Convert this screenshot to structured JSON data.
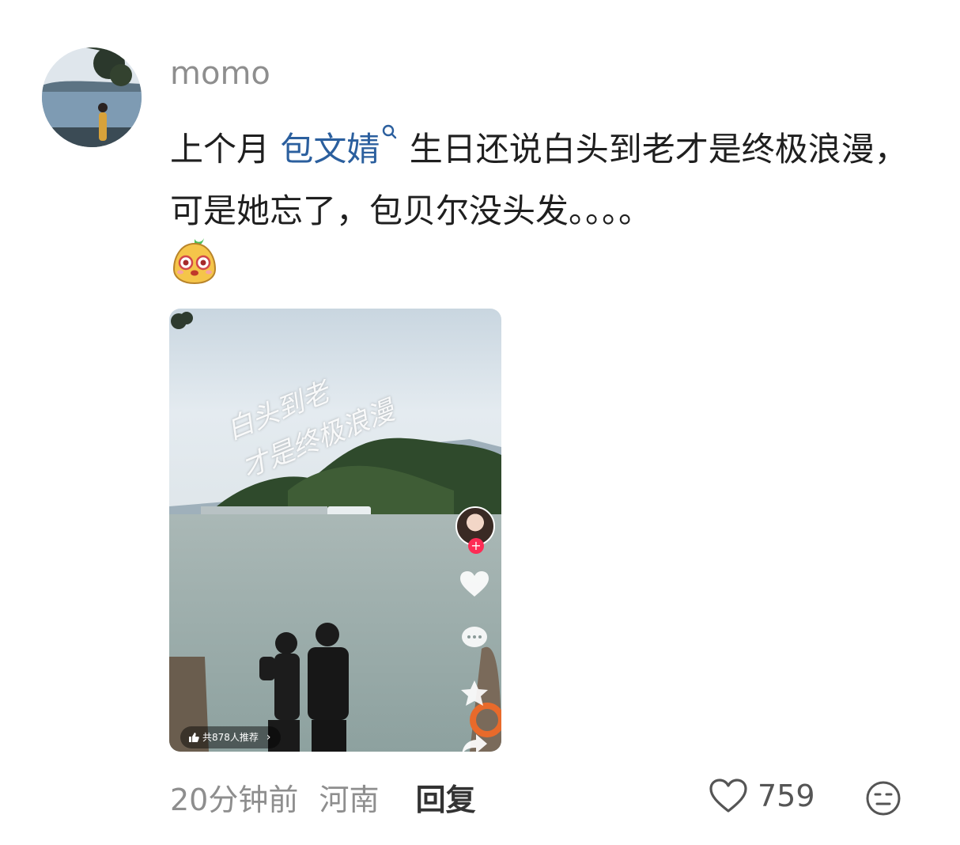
{
  "comment": {
    "username": "momo",
    "text_before": "上个月 ",
    "mention": "包文婧",
    "text_after": " 生日还说白头到老才是终极浪漫，可是她忘了，包贝尔没头发。。。。",
    "media": {
      "overlay_text_line1": "白头到老",
      "overlay_text_line2": "才是终极浪漫",
      "recommend_text": "共878人推荐"
    },
    "timestamp": "20分钟前",
    "location": "河南",
    "reply_label": "回复",
    "like_count": "759"
  },
  "icons": {
    "avatar": "avatar",
    "mention": "search-icon",
    "sticker": "cute-emoji-sticker",
    "media_like": "heart-icon",
    "media_comment": "comment-icon",
    "media_favorite": "star-icon",
    "media_share": "share-icon",
    "like": "heart-outline-icon",
    "reaction": "emoji-reaction-icon"
  },
  "colors": {
    "mention": "#2b5f9e",
    "secondary_text": "#8e8e8e",
    "follow_button": "#fe2c55"
  }
}
